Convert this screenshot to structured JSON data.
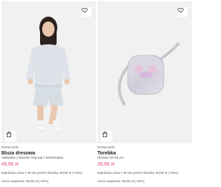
{
  "products": [
    {
      "label": "Dziewczynki",
      "name": "Bluza dresowa",
      "desc": "niebieska z fasonie crop top z kieszeniami",
      "price": "49,90 zł",
      "lowest": "Najniższa cena z 30 dni przed obniżką: 89,90 zł (-44%)",
      "regular": "Cena regularna: 89,90 zł (-44%)"
    },
    {
      "label": "Dziewczynki",
      "name": "Torebka",
      "desc": "różowa 13×15 cm",
      "price": "39,90 zł",
      "lowest": "Najniższa cena z 30 dni przed obniżką: 59,90 zł (-33%)",
      "regular": "Cena regularna: 59,90 zł (-33%)"
    }
  ],
  "icons": {
    "favorite": "heart-icon",
    "cart": "shopping-bag-icon"
  },
  "colors": {
    "price": "#e2496b",
    "card_bg": "#f1f1f1"
  }
}
